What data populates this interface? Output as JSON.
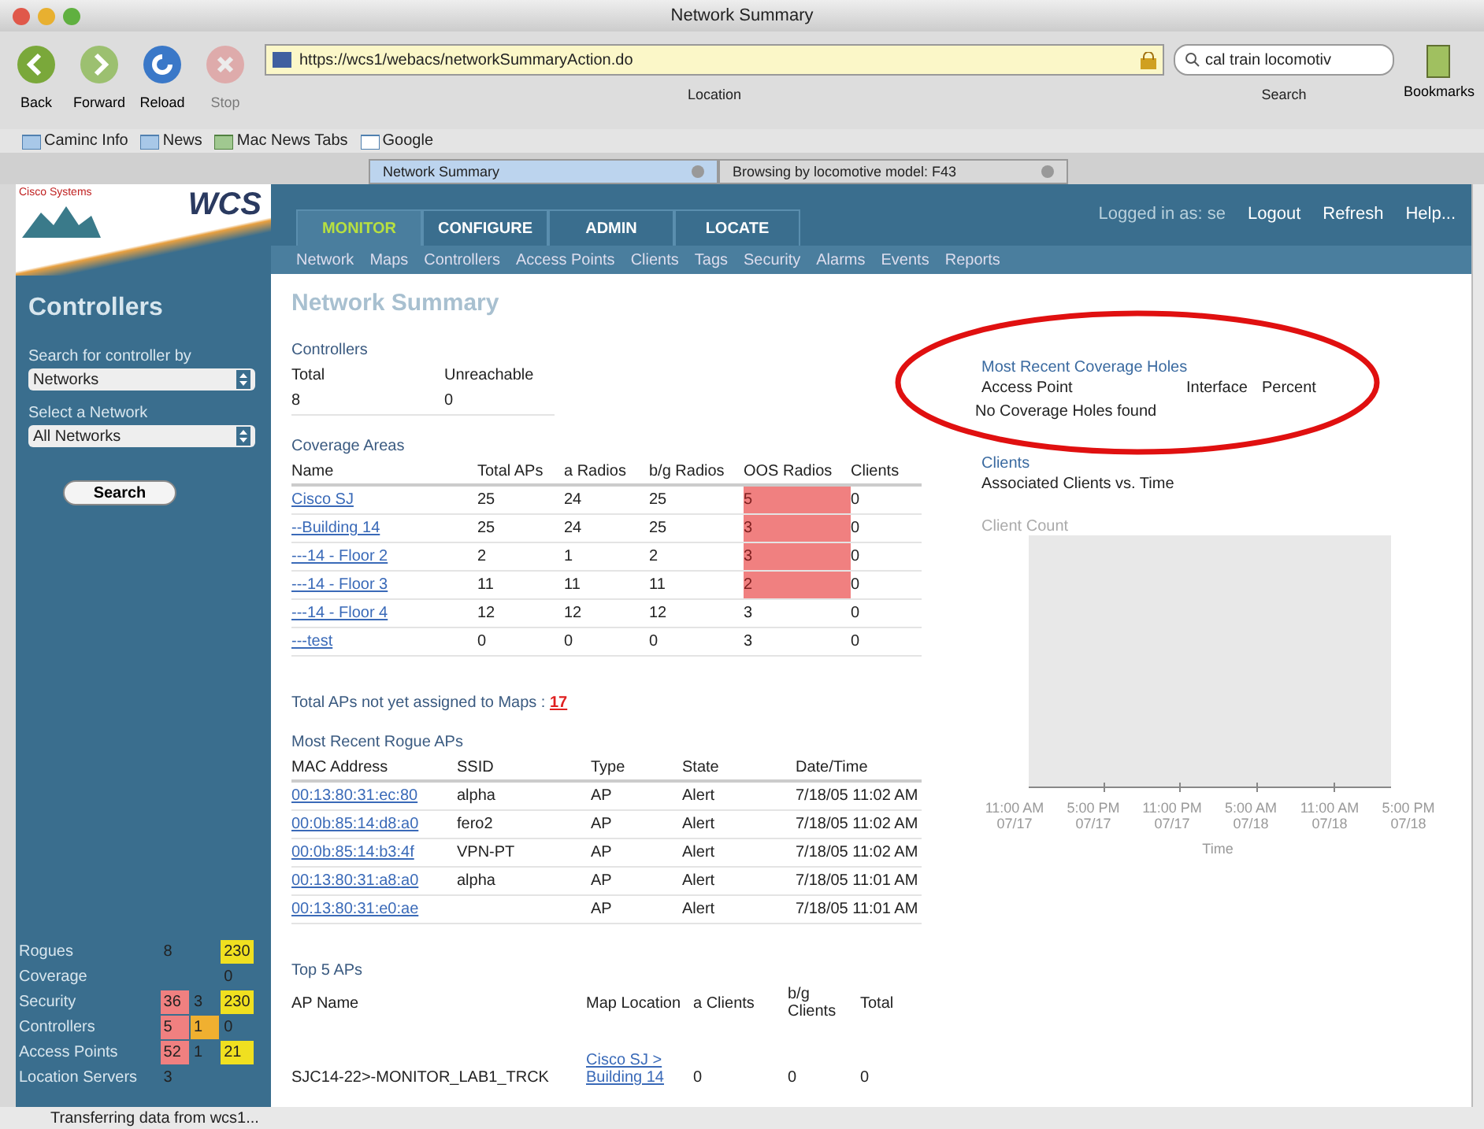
{
  "window": {
    "title": "Network Summary"
  },
  "toolbar": {
    "buttons": [
      {
        "label": "Back",
        "kind": "back",
        "disabled": false
      },
      {
        "label": "Forward",
        "kind": "forward",
        "disabled": false
      },
      {
        "label": "Reload",
        "kind": "reload",
        "disabled": false
      },
      {
        "label": "Stop",
        "kind": "stop",
        "disabled": true
      }
    ],
    "location": {
      "value": "https://wcs1/webacs/networkSummaryAction.do",
      "label": "Location"
    },
    "search": {
      "value": "cal train locomotiv",
      "label": "Search"
    },
    "bookmarks_label": "Bookmarks"
  },
  "bookmarks_bar": [
    {
      "label": "Caminc Info",
      "kind": "folder"
    },
    {
      "label": "News",
      "kind": "folder"
    },
    {
      "label": "Mac News Tabs",
      "kind": "tabs"
    },
    {
      "label": "Google",
      "kind": "google"
    }
  ],
  "browser_tabs": [
    {
      "label": "Network Summary",
      "selected": true
    },
    {
      "label": "Browsing by locomotive model: F43",
      "selected": false
    }
  ],
  "app": {
    "brand": "Cisco Systems",
    "logo": "WCS",
    "nav_tabs": [
      {
        "label": "MONITOR",
        "selected": true
      },
      {
        "label": "CONFIGURE",
        "selected": false
      },
      {
        "label": "ADMIN",
        "selected": false
      },
      {
        "label": "LOCATE",
        "selected": false
      }
    ],
    "user_links": [
      {
        "label": "Logged in as: se",
        "kind": "text"
      },
      {
        "label": "Logout",
        "kind": "link"
      },
      {
        "label": "Refresh",
        "kind": "link"
      },
      {
        "label": "Help...",
        "kind": "link"
      }
    ],
    "subnav": [
      "Network",
      "Maps",
      "Controllers",
      "Access Points",
      "Clients",
      "Tags",
      "Security",
      "Alarms",
      "Events",
      "Reports"
    ]
  },
  "sidebar": {
    "title": "Controllers",
    "search_by": {
      "label": "Search for controller by",
      "value": "Networks"
    },
    "network": {
      "label": "Select a Network",
      "value": "All Networks"
    },
    "search_button": "Search",
    "alarm_summary": [
      {
        "label": "Rogues",
        "cells": [
          {
            "value": "8"
          },
          {},
          {
            "value": "230",
            "color": "#f0e020"
          }
        ]
      },
      {
        "label": "Coverage",
        "cells": [
          {},
          {},
          {
            "value": "0"
          }
        ]
      },
      {
        "label": "Security",
        "cells": [
          {
            "value": "36",
            "color": "#f08080"
          },
          {
            "value": "3"
          },
          {
            "value": "230",
            "color": "#f0e020"
          }
        ]
      },
      {
        "label": "Controllers",
        "cells": [
          {
            "value": "5",
            "color": "#f08080"
          },
          {
            "value": "1",
            "color": "#f0b030"
          },
          {
            "value": "0"
          }
        ]
      },
      {
        "label": "Access Points",
        "cells": [
          {
            "value": "52",
            "color": "#f08080"
          },
          {
            "value": "1"
          },
          {
            "value": "21",
            "color": "#f0e020"
          }
        ]
      },
      {
        "label": "Location Servers",
        "cells": [
          {
            "value": "3"
          },
          {},
          {}
        ]
      }
    ]
  },
  "page_title": "Network Summary",
  "controllers": {
    "title": "Controllers",
    "columns": [
      "Total",
      "Unreachable"
    ],
    "values": [
      "8",
      "0"
    ]
  },
  "coverage_areas": {
    "title": "Coverage Areas",
    "columns": [
      "Name",
      "Total APs",
      "a Radios",
      "b/g Radios",
      "OOS Radios",
      "Clients"
    ],
    "rows": [
      {
        "name": "Cisco SJ",
        "total": "25",
        "a": "24",
        "bg": "25",
        "oos": "5",
        "clients": "0",
        "oos_alert": true
      },
      {
        "name": "--Building 14",
        "total": "25",
        "a": "24",
        "bg": "25",
        "oos": "3",
        "clients": "0",
        "oos_alert": true
      },
      {
        "name": "---14 - Floor 2",
        "total": "2",
        "a": "1",
        "bg": "2",
        "oos": "3",
        "clients": "0",
        "oos_alert": true
      },
      {
        "name": "---14 - Floor 3",
        "total": "11",
        "a": "11",
        "bg": "11",
        "oos": "2",
        "clients": "0",
        "oos_alert": true
      },
      {
        "name": "---14 - Floor 4",
        "total": "12",
        "a": "12",
        "bg": "12",
        "oos": "3",
        "clients": "0",
        "oos_alert": false
      },
      {
        "name": "---test",
        "total": "0",
        "a": "0",
        "bg": "0",
        "oos": "3",
        "clients": "0",
        "oos_alert": false
      }
    ]
  },
  "unassigned": {
    "label": "Total APs not yet assigned to Maps :",
    "count": "17"
  },
  "rogue_aps": {
    "title": "Most Recent Rogue APs",
    "columns": [
      "MAC Address",
      "SSID",
      "Type",
      "State",
      "Date/Time"
    ],
    "rows": [
      {
        "mac": "00:13:80:31:ec:80",
        "ssid": "alpha",
        "type": "AP",
        "state": "Alert",
        "time": "7/18/05 11:02 AM"
      },
      {
        "mac": "00:0b:85:14:d8:a0",
        "ssid": "fero2",
        "type": "AP",
        "state": "Alert",
        "time": "7/18/05 11:02 AM"
      },
      {
        "mac": "00:0b:85:14:b3:4f",
        "ssid": "VPN-PT",
        "type": "AP",
        "state": "Alert",
        "time": "7/18/05 11:02 AM"
      },
      {
        "mac": "00:13:80:31:a8:a0",
        "ssid": "alpha",
        "type": "AP",
        "state": "Alert",
        "time": "7/18/05 11:01 AM"
      },
      {
        "mac": "00:13:80:31:e0:ae",
        "type": "AP",
        "state": "Alert",
        "time": "7/18/05 11:01 AM"
      }
    ]
  },
  "top_aps": {
    "title": "Top 5 APs",
    "columns": [
      "AP Name",
      "Map Location",
      "a Clients",
      "b/g Clients",
      "Total"
    ],
    "rows": [
      {
        "ap_name": "SJC14-22>-MONITOR_LAB1_TRCK",
        "map_location": "Cisco SJ > Building 14",
        "a_clients": "0",
        "bg_clients": "0",
        "total": "0"
      }
    ]
  },
  "coverage_holes": {
    "title": "Most Recent Coverage Holes",
    "columns": [
      "Access Point",
      "Interface",
      "Percent"
    ],
    "empty_text": "No Coverage Holes found"
  },
  "clients": {
    "title": "Clients",
    "subtitle": "Associated Clients vs. Time",
    "y_label": "Client Count",
    "x_ticks": [
      {
        "time": "11:00 AM",
        "date": "07/17"
      },
      {
        "time": "5:00 PM",
        "date": "07/17"
      },
      {
        "time": "11:00 PM",
        "date": "07/17"
      },
      {
        "time": "5:00 AM",
        "date": "07/18"
      },
      {
        "time": "11:00 AM",
        "date": "07/18"
      },
      {
        "time": "5:00 PM",
        "date": "07/18"
      }
    ],
    "x_label": "Time"
  },
  "status_bar": "Transferring data from wcs1..."
}
